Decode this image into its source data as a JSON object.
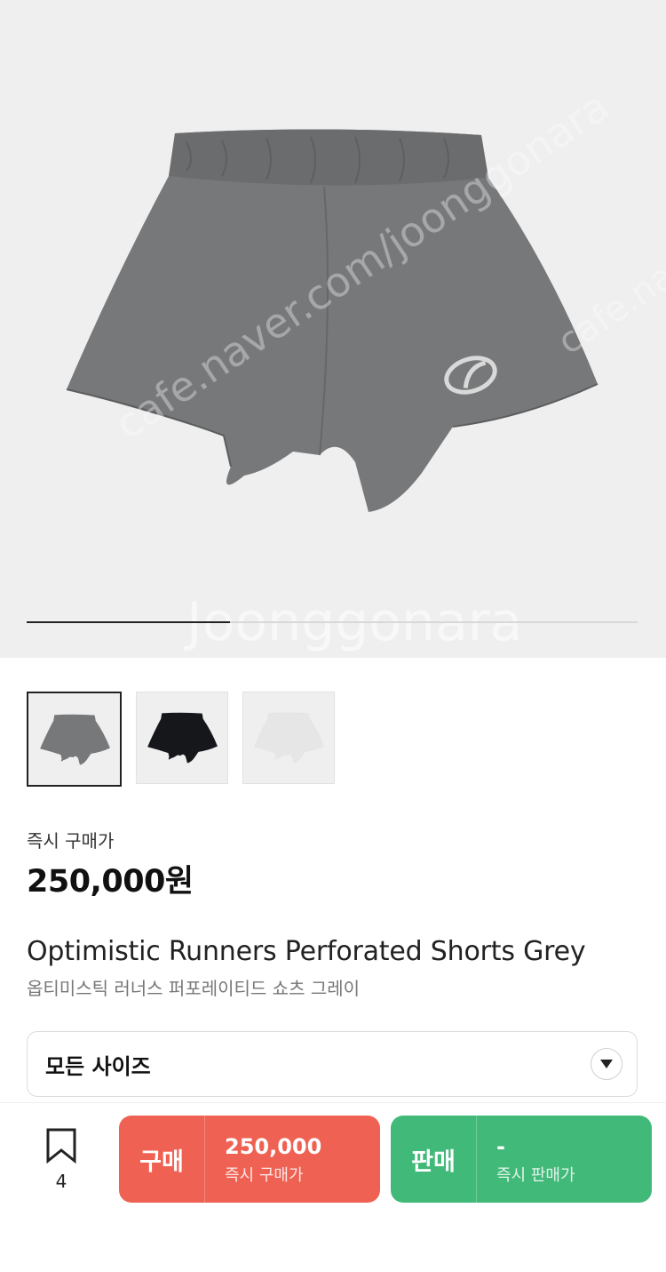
{
  "gallery": {
    "watermarks": [
      "cafe.naver.com/joonggonara",
      "Joonggonara",
      "cafe.naver"
    ],
    "current_slide": 1,
    "total_slides": 3,
    "thumbnails": [
      {
        "name": "thumbnail-grey",
        "color": "#77787a",
        "selected": true
      },
      {
        "name": "thumbnail-black",
        "color": "#16171b",
        "selected": false
      },
      {
        "name": "thumbnail-white",
        "color": "#e6e6e6",
        "selected": false
      }
    ]
  },
  "product": {
    "price_label": "즉시 구매가",
    "price": "250,000원",
    "title_en": "Optimistic Runners Perforated Shorts Grey",
    "title_ko": "옵티미스틱 러너스 퍼포레이티드 쇼츠 그레이"
  },
  "size_select": {
    "label": "모든 사이즈",
    "icon": "chevron-down-icon"
  },
  "bottom_bar": {
    "bookmark_count": "4",
    "buy": {
      "label": "구매",
      "amount": "250,000",
      "sub": "즉시 구매가",
      "color": "#ef6253"
    },
    "sell": {
      "label": "판매",
      "amount": "-",
      "sub": "즉시 판매가",
      "color": "#41b979"
    }
  }
}
